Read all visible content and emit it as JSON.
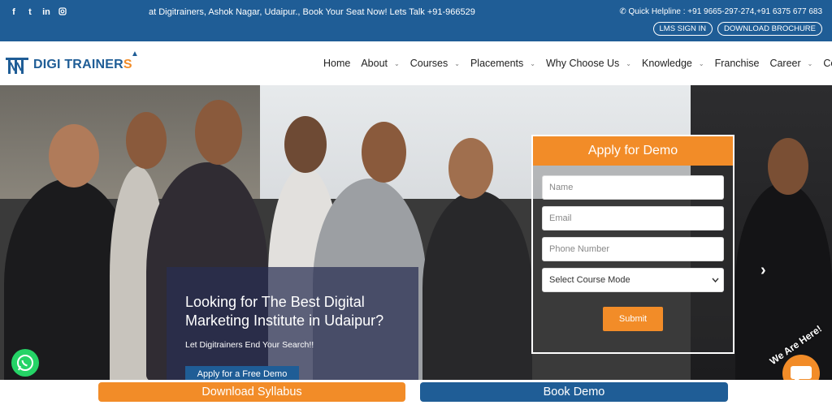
{
  "topbar": {
    "promo": "at Digitrainers, Ashok Nagar, Udaipur., Book Your Seat Now! Lets Talk +91-966529",
    "helpline": "Quick Helpline : +91 9665-297-274,+91 6375 677 683",
    "lms_signin": "LMS SIGN IN",
    "download_brochure": "DOWNLOAD BROCHURE",
    "social": [
      "f",
      "t",
      "in",
      "ig"
    ]
  },
  "brand": {
    "name_main": "DIGI TRAINER",
    "name_accent": "S"
  },
  "nav": {
    "items": [
      {
        "label": "Home",
        "dropdown": false
      },
      {
        "label": "About",
        "dropdown": true
      },
      {
        "label": "Courses",
        "dropdown": true
      },
      {
        "label": "Placements",
        "dropdown": true
      },
      {
        "label": "Why Choose Us",
        "dropdown": true
      },
      {
        "label": "Knowledge",
        "dropdown": true
      },
      {
        "label": "Franchise",
        "dropdown": false
      },
      {
        "label": "Career",
        "dropdown": true
      },
      {
        "label": "Contact",
        "dropdown": false
      }
    ],
    "caret": "⌄"
  },
  "hero": {
    "title": "Looking for The Best Digital Marketing Institute in Udaipur?",
    "subtitle": "Let Digitrainers End Your Search!!",
    "cta": "Apply for a Free Demo"
  },
  "form": {
    "title": "Apply for Demo",
    "name_placeholder": "Name",
    "email_placeholder": "Email",
    "phone_placeholder": "Phone Number",
    "mode_selected": "Select Course Mode",
    "submit": "Submit"
  },
  "widgets": {
    "we_are_here": "We Are Here!"
  },
  "bottom": {
    "download_syllabus": "Download Syllabus",
    "book_demo": "Book Demo"
  },
  "colors": {
    "brand_blue": "#1f5d96",
    "brand_orange": "#f28c28",
    "whatsapp_green": "#25d366"
  }
}
